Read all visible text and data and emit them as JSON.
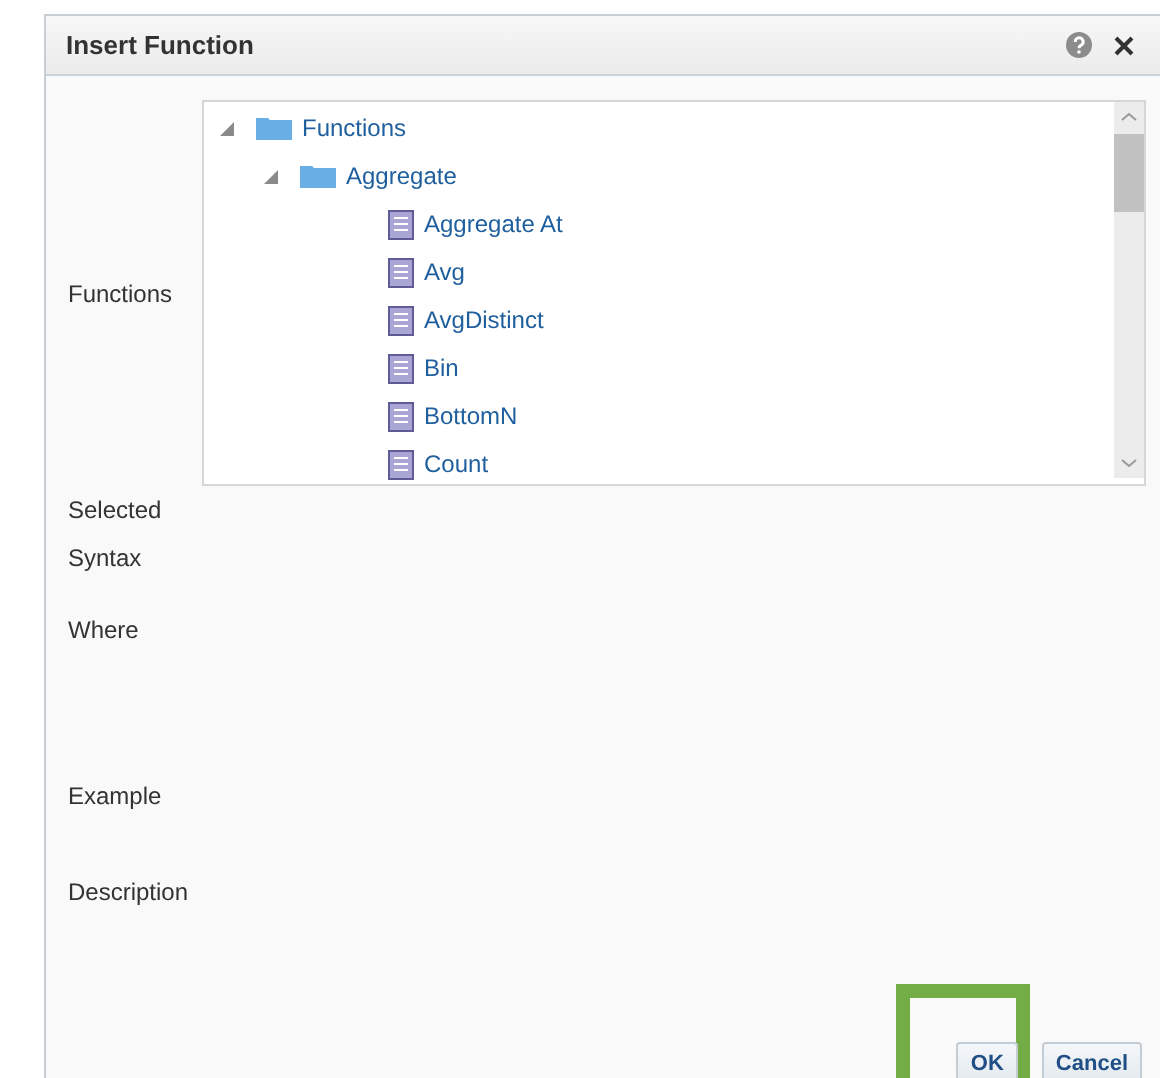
{
  "window": {
    "title": "Insert Function"
  },
  "labels": {
    "functions": "Functions",
    "selected": "Selected",
    "syntax": "Syntax",
    "where": "Where",
    "example": "Example",
    "description": "Description"
  },
  "tree": [
    {
      "label": "Functions",
      "kind": "folder",
      "expanded": true,
      "children": [
        {
          "label": "Aggregate",
          "kind": "folder",
          "expanded": true,
          "children": [
            {
              "label": "Aggregate At",
              "kind": "function"
            },
            {
              "label": "Avg",
              "kind": "function"
            },
            {
              "label": "AvgDistinct",
              "kind": "function"
            },
            {
              "label": "Bin",
              "kind": "function"
            },
            {
              "label": "BottomN",
              "kind": "function"
            },
            {
              "label": "Count",
              "kind": "function"
            }
          ]
        }
      ]
    }
  ],
  "buttons": [
    {
      "label": "OK",
      "highlighted": true
    },
    {
      "label": "Cancel",
      "highlighted": false
    }
  ]
}
